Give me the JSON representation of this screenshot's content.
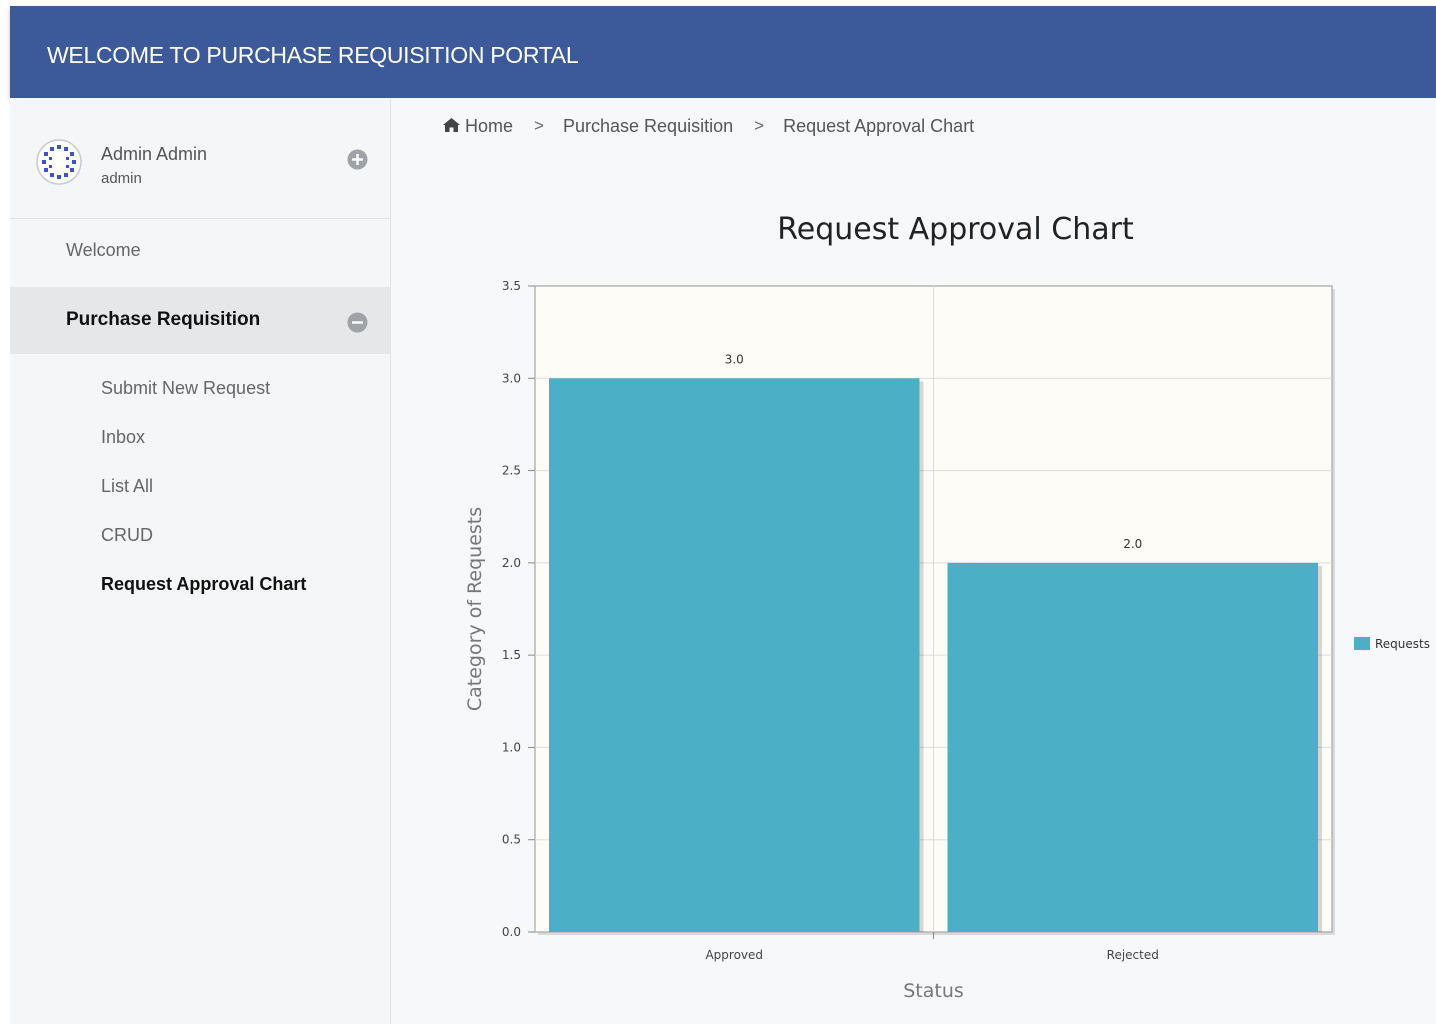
{
  "header": {
    "title": "WELCOME TO PURCHASE REQUISITION PORTAL"
  },
  "profile": {
    "name": "Admin Admin",
    "username": "admin"
  },
  "nav": {
    "welcome": "Welcome",
    "purchase_requisition": "Purchase Requisition",
    "subitems": [
      "Submit New Request",
      "Inbox",
      "List All",
      "CRUD",
      "Request Approval Chart"
    ],
    "active_subitem": "Request Approval Chart"
  },
  "breadcrumb": {
    "home": "Home",
    "sep": ">",
    "level1": "Purchase Requisition",
    "level2": "Request Approval Chart"
  },
  "colors": {
    "header": "#3c5a99",
    "bar": "#4bb0c5",
    "plot_bg": "#fdfcf7"
  },
  "chart_data": {
    "type": "bar",
    "title": "Request Approval Chart",
    "xlabel": "Status",
    "ylabel": "Category of Requests",
    "categories": [
      "Approved",
      "Rejected"
    ],
    "series": [
      {
        "name": "Requests",
        "values": [
          3.0,
          2.0
        ],
        "color": "#4bb0c5"
      }
    ],
    "data_labels": [
      "3.0",
      "2.0"
    ],
    "ylim": [
      0,
      3.5
    ],
    "yticks": [
      "0.0",
      "0.5",
      "1.0",
      "1.5",
      "2.0",
      "2.5",
      "3.0",
      "3.5"
    ],
    "grid": true,
    "legend": "right"
  }
}
